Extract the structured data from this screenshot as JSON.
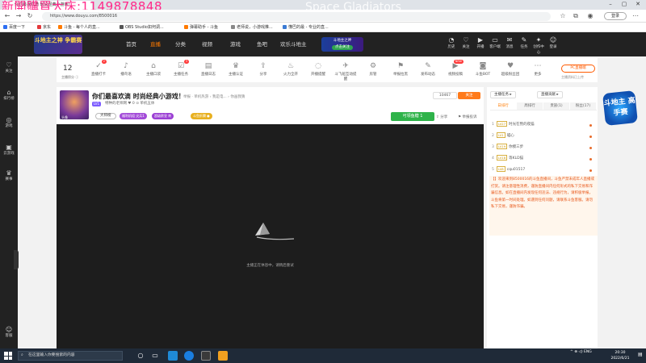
{
  "browser": {
    "overlay_text": "新開購買大床:1149878848",
    "ghost_text": "Space Gladiators",
    "tab_title": "你们最喜欢滴 时尚经典小游戏！",
    "url": "https://www.douyu.com/8500016",
    "login_label": "登录",
    "bookmarks": [
      {
        "label": "百度一下",
        "color": "#2d6ff2"
      },
      {
        "label": "京东",
        "color": "#e4393c"
      },
      {
        "label": "斗鱼 - 每个人的直...",
        "color": "#ff7a00"
      },
      {
        "label": "OBS Studio如何调...",
        "color": "#555555"
      },
      {
        "label": "弹幕助手 - 斗鱼",
        "color": "#ff7a00"
      },
      {
        "label": "老师说，小游戏推...",
        "color": "#888888"
      },
      {
        "label": "懂巴的最 - 专业的直...",
        "color": "#3b7bd4"
      }
    ]
  },
  "header": {
    "logo_text": "斗地主之神 争霸赛",
    "nav": [
      "首页",
      "直播",
      "分类",
      "视频",
      "游戏",
      "鱼吧",
      "欢乐斗地主"
    ],
    "active_nav": "直播",
    "promo_title": "斗地主之神",
    "promo_button": "点击关注",
    "icons": [
      {
        "label": "历史",
        "glyph": "◔"
      },
      {
        "label": "关注",
        "glyph": "♡"
      },
      {
        "label": "开播",
        "glyph": "▶"
      },
      {
        "label": "客户端",
        "glyph": "▭"
      },
      {
        "label": "消息",
        "glyph": "✉"
      },
      {
        "label": "任务",
        "glyph": "✎"
      },
      {
        "label": "创作中心",
        "glyph": "✦"
      },
      {
        "label": "登录",
        "glyph": "☺"
      }
    ]
  },
  "sidebar": [
    {
      "label": "关注",
      "glyph": "♡"
    },
    {
      "label": "排行榜",
      "glyph": "⌂"
    },
    {
      "label": "游戏",
      "glyph": "◎"
    },
    {
      "label": "云游戏",
      "glyph": "▣"
    },
    {
      "label": "赛事",
      "glyph": "♛"
    },
    {
      "label": "客服",
      "glyph": "☺"
    }
  ],
  "toolbar": {
    "points_value": "12",
    "points_label": "主播积分 ⓘ",
    "items": [
      {
        "label": "直播打卡",
        "glyph": "✓",
        "badge": "2"
      },
      {
        "label": "播鸟语",
        "glyph": "♪",
        "badge": ""
      },
      {
        "label": "主播口袋",
        "glyph": "⌂",
        "badge": ""
      },
      {
        "label": "主播任务",
        "glyph": "☑",
        "badge": "3"
      },
      {
        "label": "直播日志",
        "glyph": "▤",
        "badge": ""
      },
      {
        "label": "主播认证",
        "glyph": "♛",
        "badge": ""
      },
      {
        "label": "分享",
        "glyph": "⇪",
        "badge": ""
      },
      {
        "label": "火力全开",
        "glyph": "♨",
        "badge": ""
      },
      {
        "label": "开播提醒",
        "glyph": "◌",
        "badge": ""
      },
      {
        "label": "斗飞船互动提醒",
        "glyph": "✈",
        "badge": ""
      },
      {
        "label": "房管",
        "glyph": "⚙",
        "badge": ""
      },
      {
        "label": "举报拉黑",
        "glyph": "⚑",
        "badge": ""
      },
      {
        "label": "发布动态",
        "glyph": "✎",
        "badge": ""
      },
      {
        "label": "视频投稿",
        "glyph": "▶",
        "badge": "NEW"
      },
      {
        "label": "斗鱼BOT",
        "glyph": "◙",
        "badge": ""
      },
      {
        "label": "超级粉丝团",
        "glyph": "♥",
        "badge": ""
      },
      {
        "label": "更多",
        "glyph": "⋯",
        "badge": ""
      }
    ],
    "pc_button": "PC直播端",
    "pc_sub": "主播资料已上传"
  },
  "room": {
    "title": "你们最喜欢滴 时尚经典小游戏！",
    "category": "举报 · 单机热游 › 我是电... › 你画我猜",
    "level_badge": "LV1",
    "anchor_name": "特种的老师网  ♥ 0  ⊙ 单机五体",
    "rank_tag": "大师榜",
    "tags": [
      {
        "label": "福利机组  尖兵1",
        "color": "#a34bd8"
      },
      {
        "label": "超级欧皇 刺",
        "color": "#9b3fd4"
      },
      {
        "label": "斗鱼折腾 ●",
        "color": "#e8b020"
      }
    ],
    "viewers": "10467",
    "follow_label": "关注",
    "candy_label": "可领鱼糖 1",
    "share_label": "分享",
    "report_label": "举报投诉"
  },
  "video": {
    "offline_text": "主播正在休息中，请稍后重试"
  },
  "rightpanel": {
    "btn_a": "主播任务 ▸",
    "btn_b": "直播贡献 ▸",
    "tabs": [
      "日排行",
      "周排行",
      "贵族(1)",
      "粉丝(17)"
    ],
    "active_tab": "日排行",
    "ranks": [
      {
        "num": "1",
        "lv": "LV27",
        "name": "时光在熬的夜猫"
      },
      {
        "num": "2",
        "lv": "LV1",
        "name": "喵心"
      },
      {
        "num": "3",
        "lv": "LV19",
        "name": "你摸三步"
      },
      {
        "num": "4",
        "lv": "LV18",
        "name": "等KLD猫"
      },
      {
        "num": "5",
        "lv": "LV8",
        "name": "cqu01517"
      }
    ],
    "notice": "【】欢迎来到8500016的斗鱼直播间，斗鱼严禁未成年人直播或打赏。请注意理性消费，谨防直播间内任何形式的私下交易和诈骗信息。如在直播间内发现任何违法、违规行为，请积极举报，斗鱼将第一时间处理。如遇到任何问题，请联系斗鱼客服。请勿私下交易，谨防诈骗。",
    "game_badge": "斗地主 高手赛"
  },
  "taskbar": {
    "search_placeholder": "在这里输入你要搜索的内容",
    "tray": "^  ⊕  ◁)  ENG",
    "time": "20:30",
    "date": "2022/6/21"
  }
}
